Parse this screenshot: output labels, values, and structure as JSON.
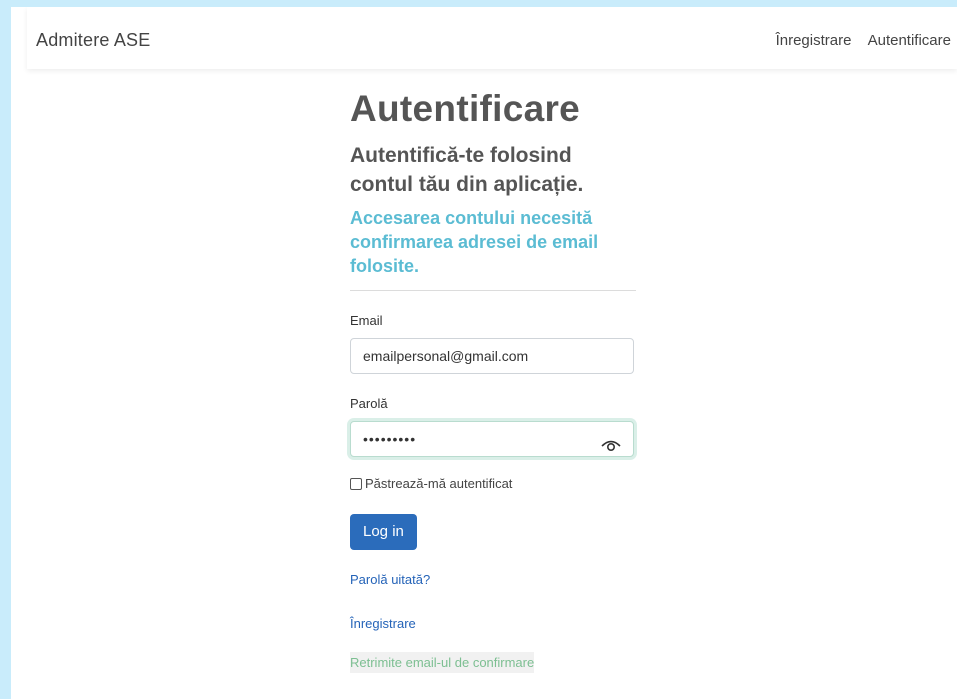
{
  "navbar": {
    "brand": "Admitere ASE",
    "links": [
      "Înregistrare",
      "Autentificare"
    ]
  },
  "page": {
    "title": "Autentificare",
    "subtitle": "Autentifică-te folosind contul tău din aplicație.",
    "notice": "Accesarea contului necesită confirmarea adresei de email folosite."
  },
  "form": {
    "email_label": "Email",
    "email_value": "emailpersonal@gmail.com",
    "password_label": "Parolă",
    "password_value": "•••••••••",
    "remember_label": "Păstrează-mă autentificat",
    "login_button": "Log in"
  },
  "links": {
    "forgot": "Parolă uitată?",
    "register": "Înregistrare",
    "resend": "Retrimite email-ul de confirmare"
  },
  "colors": {
    "primary": "#2b6cbb",
    "info": "#5bbcd3",
    "background": "#c9ecfb"
  }
}
